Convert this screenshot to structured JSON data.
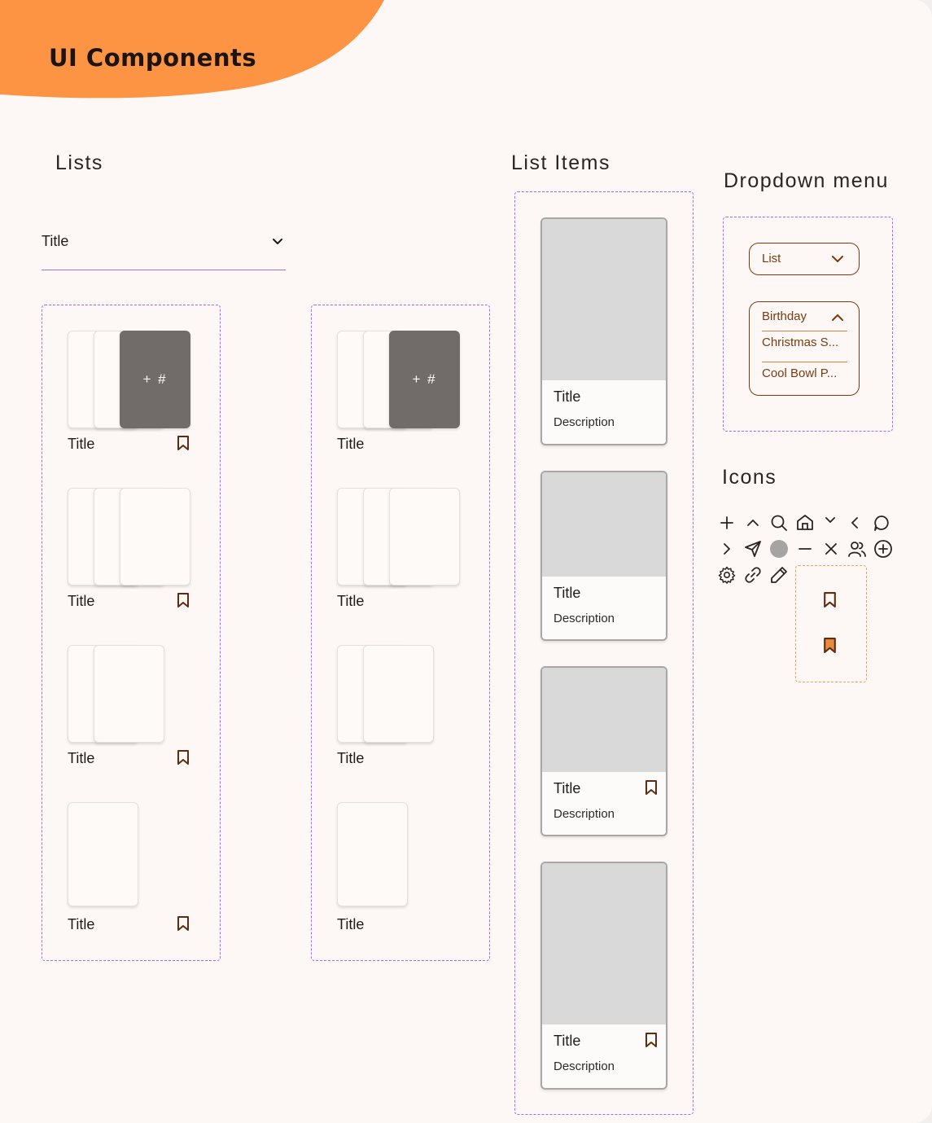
{
  "page": {
    "title": "UI Components"
  },
  "colors": {
    "accent_orange": "#fc9443",
    "dashed_purple": "#9b6bff",
    "dropdown_brown": "#7a3a10",
    "placeholder_gray": "#d9d9d9",
    "dark_card": "#716c69"
  },
  "sections": {
    "lists": "Lists",
    "list_items": "List Items",
    "dropdown_menu": "Dropdown menu",
    "icons": "Icons"
  },
  "title_select": {
    "label": "Title",
    "icon": "chevron-down-icon"
  },
  "lists": {
    "col1": [
      {
        "title": "Title",
        "stack": 3,
        "dark_label": "+ #",
        "bookmark": true
      },
      {
        "title": "Title",
        "stack": 3,
        "bookmark": true
      },
      {
        "title": "Title",
        "stack": 2,
        "bookmark": true
      },
      {
        "title": "Title",
        "stack": 1,
        "bookmark": true
      }
    ],
    "col2": [
      {
        "title": "Title",
        "stack": 3,
        "dark_label": "+ #"
      },
      {
        "title": "Title",
        "stack": 3
      },
      {
        "title": "Title",
        "stack": 2
      },
      {
        "title": "Title",
        "stack": 1
      }
    ]
  },
  "list_items": [
    {
      "title": "Title",
      "description": "Description",
      "bookmark": false
    },
    {
      "title": "Title",
      "description": "Description",
      "bookmark": false
    },
    {
      "title": "Title",
      "description": "Description",
      "bookmark": true
    },
    {
      "title": "Title",
      "description": "Description",
      "bookmark": true
    }
  ],
  "dropdown": {
    "closed_value": "List",
    "open_options": [
      "Birthday",
      "Christmas S...",
      "Cool Bowl P..."
    ]
  },
  "icons": [
    "plus-icon",
    "chevron-up-icon",
    "search-icon",
    "home-icon",
    "chevron-down-icon",
    "chevron-left-icon",
    "chat-bubble-icon",
    "chevron-right-icon",
    "send-icon",
    "circle-filled-icon",
    "minus-icon",
    "close-icon",
    "users-icon",
    "add-circle-icon",
    "gear-icon",
    "link-icon",
    "pencil-icon",
    "bookmark-outline-icon",
    "bookmark-filled-icon"
  ]
}
